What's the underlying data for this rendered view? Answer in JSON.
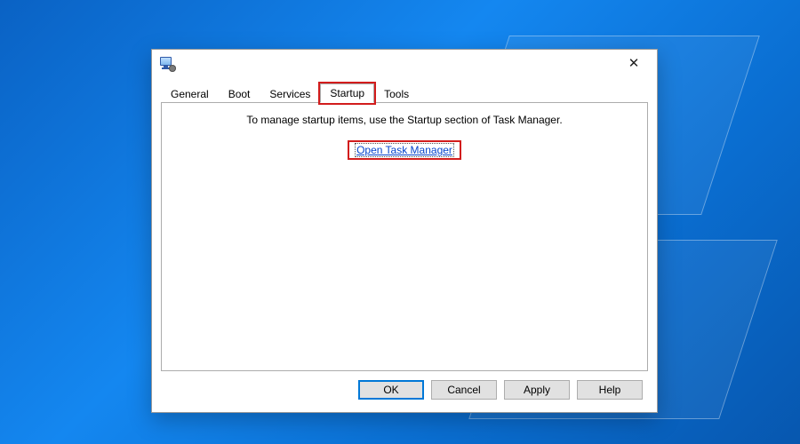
{
  "window": {
    "title": "",
    "close_glyph": "✕"
  },
  "tabs": {
    "items": [
      {
        "label": "General"
      },
      {
        "label": "Boot"
      },
      {
        "label": "Services"
      },
      {
        "label": "Startup"
      },
      {
        "label": "Tools"
      }
    ],
    "active_index": 3,
    "highlighted_index": 3
  },
  "content": {
    "message": "To manage startup items, use the Startup section of Task Manager.",
    "link_label": "Open Task Manager"
  },
  "buttons": {
    "ok": "OK",
    "cancel": "Cancel",
    "apply": "Apply",
    "help": "Help"
  }
}
